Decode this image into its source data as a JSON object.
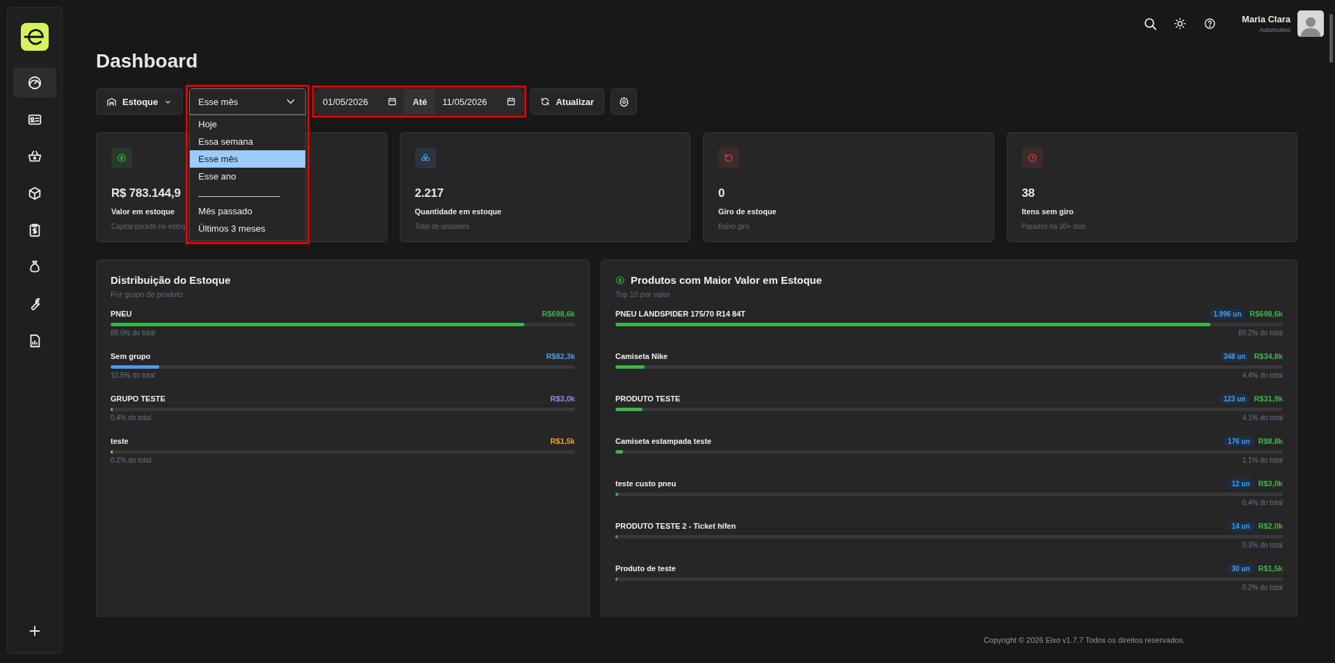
{
  "sidebar": {
    "items": [
      {
        "selected": true
      },
      {
        "selected": false
      },
      {
        "selected": false
      },
      {
        "selected": false
      },
      {
        "selected": false
      },
      {
        "selected": false
      },
      {
        "selected": false
      },
      {
        "selected": false
      }
    ]
  },
  "header": {
    "user": {
      "name": "Maria Clara",
      "role": "Automotivo"
    }
  },
  "page": {
    "title": "Dashboard"
  },
  "toolbar": {
    "stock_button": "Estoque",
    "period_select": {
      "value": "Esse mês",
      "expanded": true,
      "highlighted": true,
      "options": [
        {
          "kind": "option",
          "label": "Hoje",
          "selected": false
        },
        {
          "kind": "option",
          "label": "Essa semana",
          "selected": false
        },
        {
          "kind": "option",
          "label": "Esse mês",
          "selected": true
        },
        {
          "kind": "option",
          "label": "Esse ano",
          "selected": false
        },
        {
          "kind": "separator"
        },
        {
          "kind": "option",
          "label": "Mês passado",
          "selected": false
        },
        {
          "kind": "option",
          "label": "Últimos 3 meses",
          "selected": false
        }
      ]
    },
    "date_range": {
      "from": "01/05/2026",
      "separator": "Até",
      "to": "11/05/2026",
      "highlighted": true
    },
    "refresh_button": "Atualizar"
  },
  "stat_cards": [
    {
      "value": "R$ 783.144,9",
      "label": "Valor em estoque",
      "subtitle": "Capital parado no estoq",
      "color": "#3cb54a"
    },
    {
      "value": "2.217",
      "label": "Quantidade em estoque",
      "subtitle": "Total de unidades",
      "color": "#4a9be8"
    },
    {
      "value": "0",
      "label": "Giro de estoque",
      "subtitle": "Baixo giro",
      "color": "#e04848"
    },
    {
      "value": "38",
      "label": "Itens sem giro",
      "subtitle": "Parados há 30+ dias",
      "color": "#e04848"
    }
  ],
  "distribution": {
    "title": "Distribuição do Estoque",
    "subtitle": "Por grupo de produto",
    "rows": [
      {
        "name": "PNEU",
        "value": "R$698,6k",
        "share": "89.0% do total",
        "level": 0.89,
        "color": "#3cb54a"
      },
      {
        "name": "Sem grupo",
        "value": "R$82,3k",
        "share": "10.5% do total",
        "level": 0.105,
        "color": "#4a9be8"
      },
      {
        "name": "GRUPO TESTE",
        "value": "R$3,0k",
        "share": "0.4% do total",
        "level": 0.004,
        "color": "#8b8cf0"
      },
      {
        "name": "teste",
        "value": "R$1,5k",
        "share": "0.2% do total",
        "level": 0.002,
        "color": "#f0a020"
      }
    ]
  },
  "top_products": {
    "title": "Produtos com Maior Valor em Estoque",
    "subtitle": "Top 10 por valor",
    "rows": [
      {
        "name": "PNEU LANDSPIDER 175/70 R14 84T",
        "quantity": "1.996 un",
        "value": "R$698,6k",
        "share": "89.2% do total",
        "level": 0.892
      },
      {
        "name": "Camiseta Nike",
        "quantity": "348 un",
        "value": "R$34,8k",
        "share": "4.4% do total",
        "level": 0.044
      },
      {
        "name": "PRODUTO TESTE",
        "quantity": "123 un",
        "value": "R$31,9k",
        "share": "4.1% do total",
        "level": 0.041
      },
      {
        "name": "Camiseta estampada teste",
        "quantity": "176 un",
        "value": "R$8,8k",
        "share": "1.1% do total",
        "level": 0.011
      },
      {
        "name": "teste custo pneu",
        "quantity": "12 un",
        "value": "R$3,0k",
        "share": "0.4% do total",
        "level": 0.004
      },
      {
        "name": "PRODUTO TESTE 2 - Ticket hífen",
        "quantity": "14 un",
        "value": "R$2,0k",
        "share": "0.3% do total",
        "level": 0.003
      },
      {
        "name": "Produto de teste",
        "quantity": "30 un",
        "value": "R$1,5k",
        "share": "0.2% do total",
        "level": 0.002
      }
    ]
  },
  "footer": {
    "copyright": "Copyright © 2026 Eixo v1.7.7 Todos os direitos reservados."
  }
}
